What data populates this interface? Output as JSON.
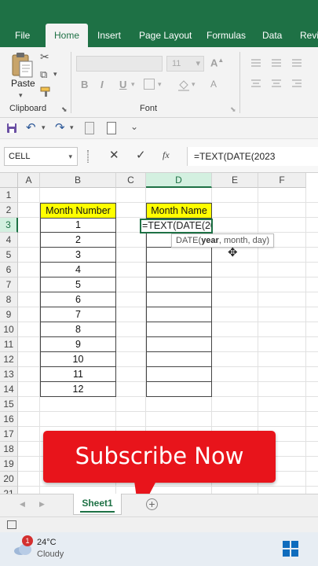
{
  "ribbon_tabs": [
    "File",
    "Home",
    "Insert",
    "Page Layout",
    "Formulas",
    "Data",
    "Revi"
  ],
  "ribbon": {
    "font_size_value": "11",
    "paste_label": "Paste",
    "clipboard_label": "Clipboard",
    "font_label": "Font",
    "bold": "B",
    "italic": "I",
    "underline": "U"
  },
  "name_box": "CELL",
  "formula_bar": {
    "fx_label": "fx",
    "content": "=TEXT(DATE(2023"
  },
  "columns": [
    "A",
    "B",
    "C",
    "D",
    "E",
    "F"
  ],
  "rows": [
    "1",
    "2",
    "3",
    "4",
    "5",
    "6",
    "7",
    "8",
    "9",
    "10",
    "11",
    "12",
    "13",
    "14",
    "15",
    "16",
    "17",
    "18",
    "19",
    "20",
    "21"
  ],
  "headers": {
    "month_number": "Month Number",
    "month_name": "Month Name"
  },
  "month_numbers": [
    "1",
    "2",
    "3",
    "4",
    "5",
    "6",
    "7",
    "8",
    "9",
    "10",
    "11",
    "12"
  ],
  "active_cell_edit": "=TEXT(DATE(2023",
  "tooltip": {
    "prefix": "DATE(",
    "bold_arg": "year",
    "rest": ", month, day)"
  },
  "banner_text": "Subscribe Now",
  "sheet_tab": "Sheet1",
  "weather": {
    "temperature": "24°C",
    "condition": "Cloudy",
    "badge": "1"
  },
  "colors": {
    "excel_green": "#1e7145",
    "header_yellow": "#ffff00",
    "banner_red": "#e8141b"
  }
}
